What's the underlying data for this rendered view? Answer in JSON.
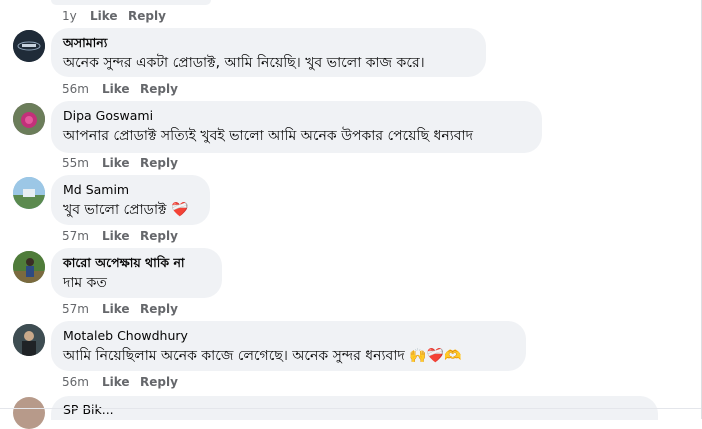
{
  "actions": {
    "like": "Like",
    "reply": "Reply"
  },
  "top_meta": {
    "time": "1y"
  },
  "comments": [
    {
      "author": "অসামান্য",
      "text": "অনেক সুন্দর একটা প্রোডাক্ট, আমি নিয়েছি। খুব ভালো কাজ করে।",
      "time": "56m"
    },
    {
      "author": "Dipa Goswami",
      "text": "আপনার প্রোডাক্ট সত্যিই খুবই ভালো আমি অনেক উপকার পেয়েছি ধন্যবাদ",
      "time": "55m"
    },
    {
      "author": "Md Samim",
      "text": "খুব ভালো প্রোডাক্ট",
      "emoji": "❤️‍🩹",
      "time": "57m"
    },
    {
      "author": "কারো অপেক্ষায় থাকি না",
      "text": "দাম কত",
      "time": "57m"
    },
    {
      "author": "Motaleb Chowdhury",
      "text": "আমি নিয়েছিলাম অনেক কাজে লেগেছে। অনেক সুন্দর ধন্যবাদ",
      "emoji": "🙌❤️‍🩹🫶",
      "time": "56m"
    }
  ],
  "last_comment": {
    "author": "SP Bik..."
  }
}
